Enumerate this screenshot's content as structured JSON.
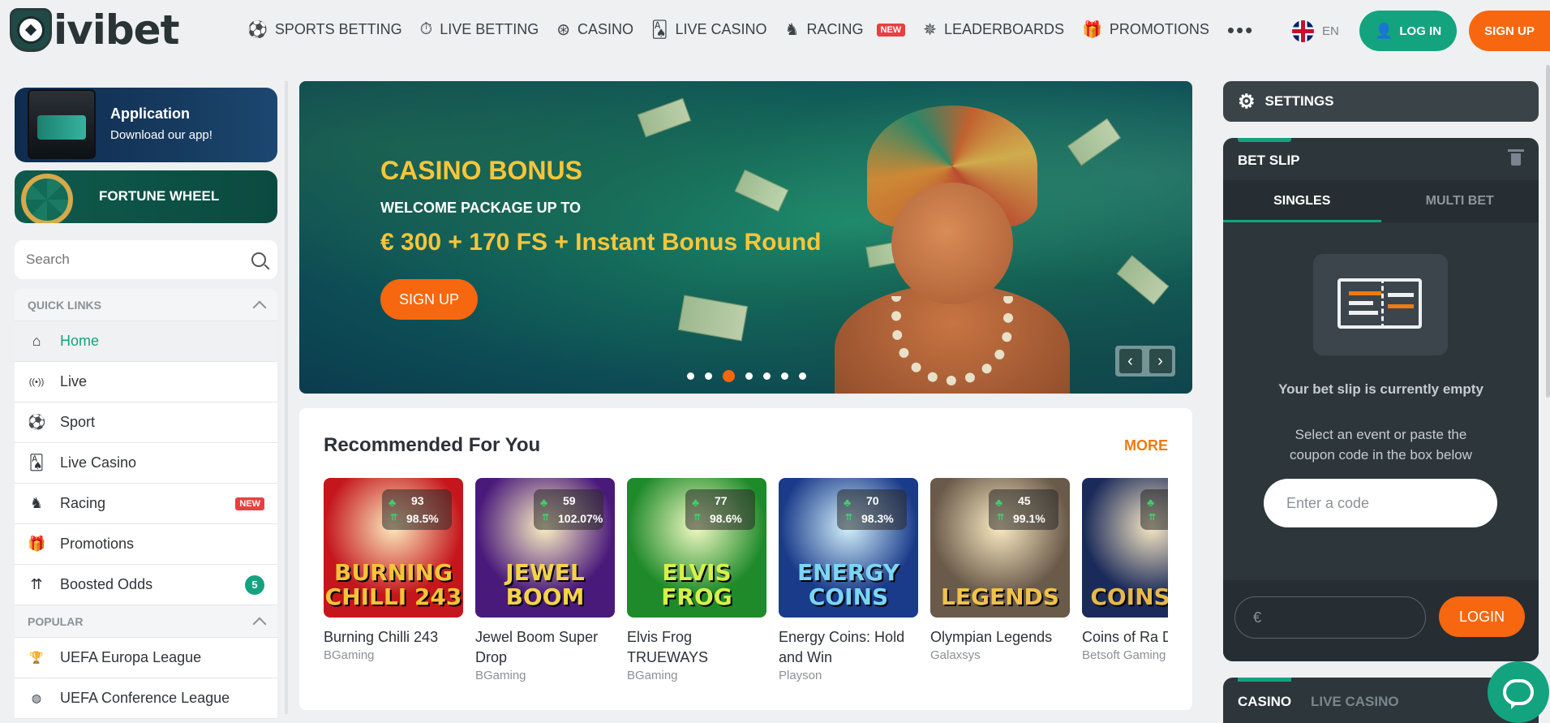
{
  "brand": {
    "logo_text": "ivibet"
  },
  "nav": {
    "items": [
      {
        "label": "SPORTS BETTING",
        "icon": "soccer-ball-icon",
        "glyph": "⚽"
      },
      {
        "label": "LIVE BETTING",
        "icon": "stopwatch-icon",
        "glyph": "⏱"
      },
      {
        "label": "CASINO",
        "icon": "roulette-icon",
        "glyph": "⊛"
      },
      {
        "label": "LIVE CASINO",
        "icon": "cards-icon",
        "glyph": "🂡"
      },
      {
        "label": "RACING",
        "icon": "horse-head-icon",
        "glyph": "♞",
        "badge": "NEW"
      },
      {
        "label": "LEADERBOARDS",
        "icon": "laurel-icon",
        "glyph": "✵"
      },
      {
        "label": "PROMOTIONS",
        "icon": "gift-icon",
        "glyph": "🎁"
      }
    ],
    "more": "•••"
  },
  "header": {
    "lang": "EN",
    "login_label": "LOG IN",
    "signup_label": "SIGN UP"
  },
  "sidebar": {
    "app_promo": {
      "title": "Application",
      "subtitle": "Download our app!"
    },
    "wheel_promo": {
      "title": "FORTUNE WHEEL"
    },
    "search_placeholder": "Search",
    "quick_links_title": "QUICK LINKS",
    "quick_links": [
      {
        "label": "Home",
        "icon": "home-icon",
        "glyph": "⌂",
        "active": true
      },
      {
        "label": "Live",
        "icon": "broadcast-icon",
        "glyph": "((•))"
      },
      {
        "label": "Sport",
        "icon": "soccer-ball-icon",
        "glyph": "⚽"
      },
      {
        "label": "Live Casino",
        "icon": "cards-icon",
        "glyph": "🂡"
      },
      {
        "label": "Racing",
        "icon": "horse-head-icon",
        "glyph": "♞",
        "badge": "NEW"
      },
      {
        "label": "Promotions",
        "icon": "gift-icon",
        "glyph": "🎁"
      },
      {
        "label": "Boosted Odds",
        "icon": "chevrons-up-icon",
        "glyph": "⇈",
        "count": "5"
      }
    ],
    "popular_title": "POPULAR",
    "popular": [
      {
        "label": "UEFA Europa League",
        "icon": "trophy-icon",
        "glyph": "🏆"
      },
      {
        "label": "UEFA Conference League",
        "icon": "europa-logo-icon",
        "glyph": "◍"
      }
    ]
  },
  "banner": {
    "title": "CASINO BONUS",
    "subtitle": "WELCOME PACKAGE UP TO",
    "amount": "€ 300 + 170 FS + Instant Bonus Round",
    "button": "SIGN UP",
    "active_slide": 3,
    "slide_count": 7
  },
  "recommended": {
    "title": "Recommended For You",
    "more": "MORE",
    "games": [
      {
        "name": "Burning Chilli 243",
        "provider": "BGaming",
        "hot": "93",
        "rtp": "98.5%",
        "art": "BURNING CHILLI 243",
        "bg": "#c4161c",
        "fg": "#f6c33a"
      },
      {
        "name": "Jewel Boom Super Drop",
        "provider": "BGaming",
        "hot": "59",
        "rtp": "102.07%",
        "art": "JEWEL BOOM",
        "bg": "#4a1a7a",
        "fg": "#f4d24a"
      },
      {
        "name": "Elvis Frog TRUEWAYS",
        "provider": "BGaming",
        "hot": "77",
        "rtp": "98.6%",
        "art": "ELVIS FROG",
        "bg": "#1f8a2a",
        "fg": "#d6f04a"
      },
      {
        "name": "Energy Coins: Hold and Win",
        "provider": "Playson",
        "hot": "70",
        "rtp": "98.3%",
        "art": "ENERGY COINS",
        "bg": "#1a3a8a",
        "fg": "#7ad6f4"
      },
      {
        "name": "Olympian Legends",
        "provider": "Galaxsys",
        "hot": "45",
        "rtp": "99.1%",
        "art": "LEGENDS",
        "bg": "#6a5a4a",
        "fg": "#f0c24a"
      },
      {
        "name": "Coins of Ra Deluxe Hold & Win",
        "provider": "Betsoft Gaming",
        "hot": "",
        "rtp": "",
        "art": "COINS RA",
        "bg": "#1a2a5a",
        "fg": "#e8b84a"
      }
    ]
  },
  "right": {
    "settings_label": "SETTINGS",
    "betslip": {
      "title": "BET SLIP",
      "tabs": [
        "SINGLES",
        "MULTI BET"
      ],
      "empty_title": "Your bet slip is currently empty",
      "empty_desc": "Select an event or paste the coupon code in the box below",
      "code_placeholder": "Enter a code",
      "currency": "€",
      "login_button": "LOGIN"
    },
    "casino_tabs": [
      "CASINO",
      "LIVE CASINO"
    ]
  },
  "colors": {
    "accent_green": "#14a37f",
    "accent_orange": "#f7670f"
  }
}
